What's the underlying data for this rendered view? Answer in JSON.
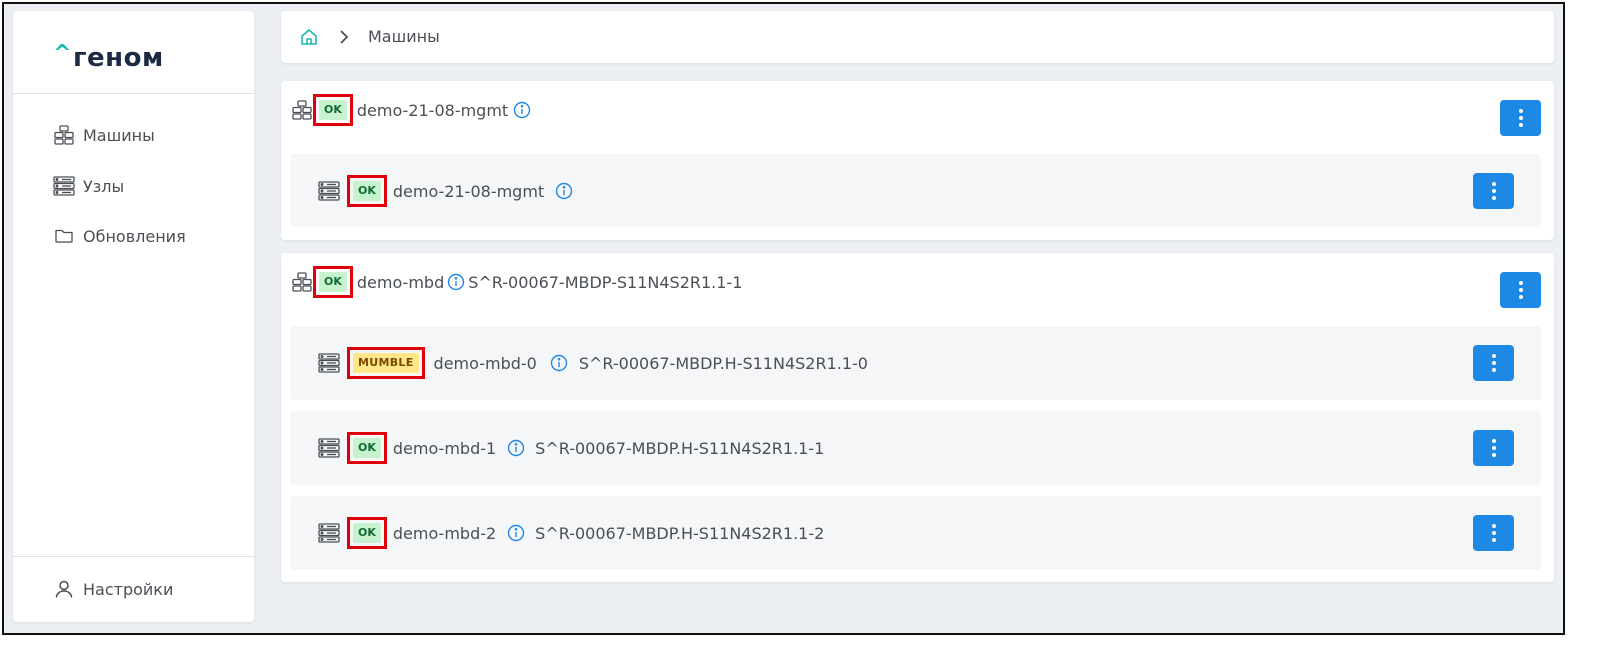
{
  "app": {
    "logo_caret": "^",
    "logo_text": "геном"
  },
  "sidebar": {
    "items": [
      {
        "label": "Машины",
        "icon": "machines-icon"
      },
      {
        "label": "Узлы",
        "icon": "nodes-icon"
      },
      {
        "label": "Обновления",
        "icon": "folder-icon"
      }
    ],
    "settings": {
      "label": "Настройки",
      "icon": "user-icon"
    }
  },
  "breadcrumb": {
    "current": "Машины"
  },
  "groups": [
    {
      "machine": {
        "name": "demo-21-08-mgmt",
        "status": "OK",
        "code": ""
      },
      "nodes": [
        {
          "name": "demo-21-08-mgmt",
          "status": "OK",
          "code": ""
        }
      ]
    },
    {
      "machine": {
        "name": "demo-mbd",
        "status": "OK",
        "code": "S^R-00067-MBDP-S11N4S2R1.1-1"
      },
      "nodes": [
        {
          "name": "demo-mbd-0",
          "status": "MUMBLE",
          "code": "S^R-00067-MBDP.H-S11N4S2R1.1-0"
        },
        {
          "name": "demo-mbd-1",
          "status": "OK",
          "code": "S^R-00067-MBDP.H-S11N4S2R1.1-1"
        },
        {
          "name": "demo-mbd-2",
          "status": "OK",
          "code": "S^R-00067-MBDP.H-S11N4S2R1.1-2"
        }
      ]
    }
  ],
  "colors": {
    "accent": "#1e88e5",
    "brand_teal": "#18b9b0",
    "ok_bg": "#c6f2cf",
    "mumble_bg": "#ffe78a",
    "highlight_border": "#e0000b"
  }
}
